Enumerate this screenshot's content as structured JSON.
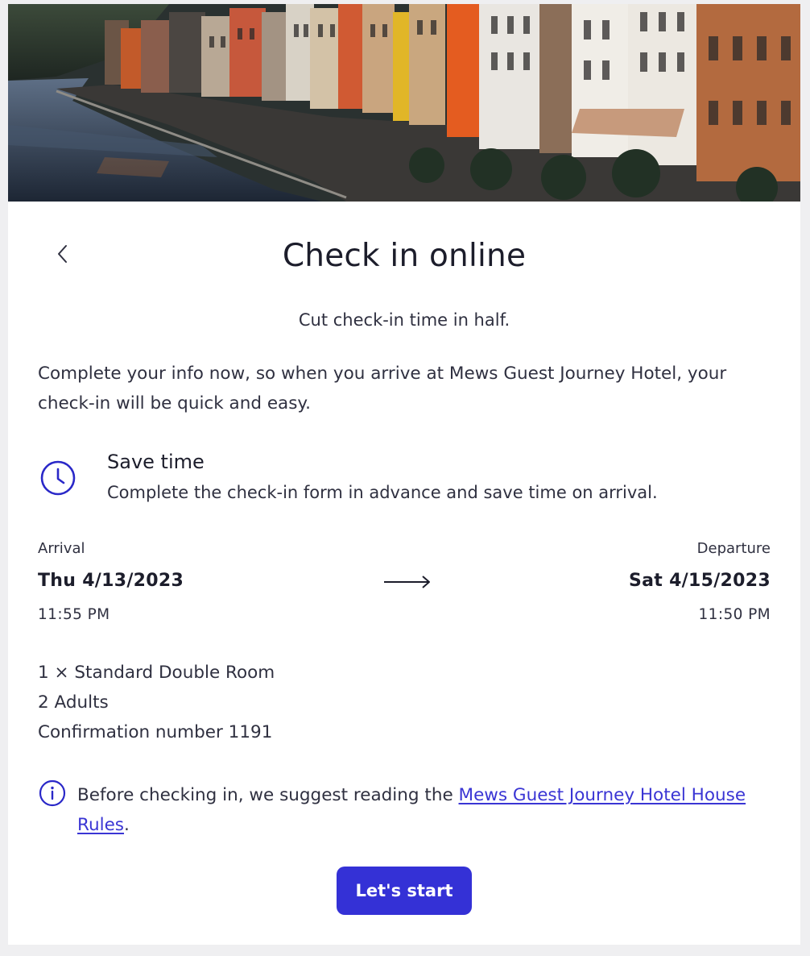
{
  "header": {
    "back_icon": "chevron-left-icon",
    "title": "Check in online",
    "subtitle": "Cut check-in time in half."
  },
  "intro": {
    "text": "Complete your info now, so when you arrive at Mews Guest Journey Hotel, your check-in will be quick and easy."
  },
  "feature": {
    "icon": "clock-icon",
    "title": "Save time",
    "description": "Complete the check-in form in advance and save time on arrival."
  },
  "stay": {
    "arrival_label": "Arrival",
    "arrival_date": "Thu 4/13/2023",
    "arrival_time": "11:55 PM",
    "arrow_icon": "arrow-right-icon",
    "departure_label": "Departure",
    "departure_date": "Sat 4/15/2023",
    "departure_time": "11:50 PM"
  },
  "booking": {
    "room": "1 × Standard Double Room",
    "guests": "2 Adults",
    "confirmation": "Confirmation number 1191"
  },
  "notice": {
    "icon": "info-icon",
    "text_before": "Before checking in, we suggest reading the ",
    "link_text": "Mews Guest Journey Hotel House Rules",
    "text_after": "."
  },
  "actions": {
    "start_label": "Let's start"
  },
  "colors": {
    "accent": "#3431d6",
    "link": "#3a35d4",
    "text": "#1c1d2b",
    "page_background": "#efeff1"
  }
}
